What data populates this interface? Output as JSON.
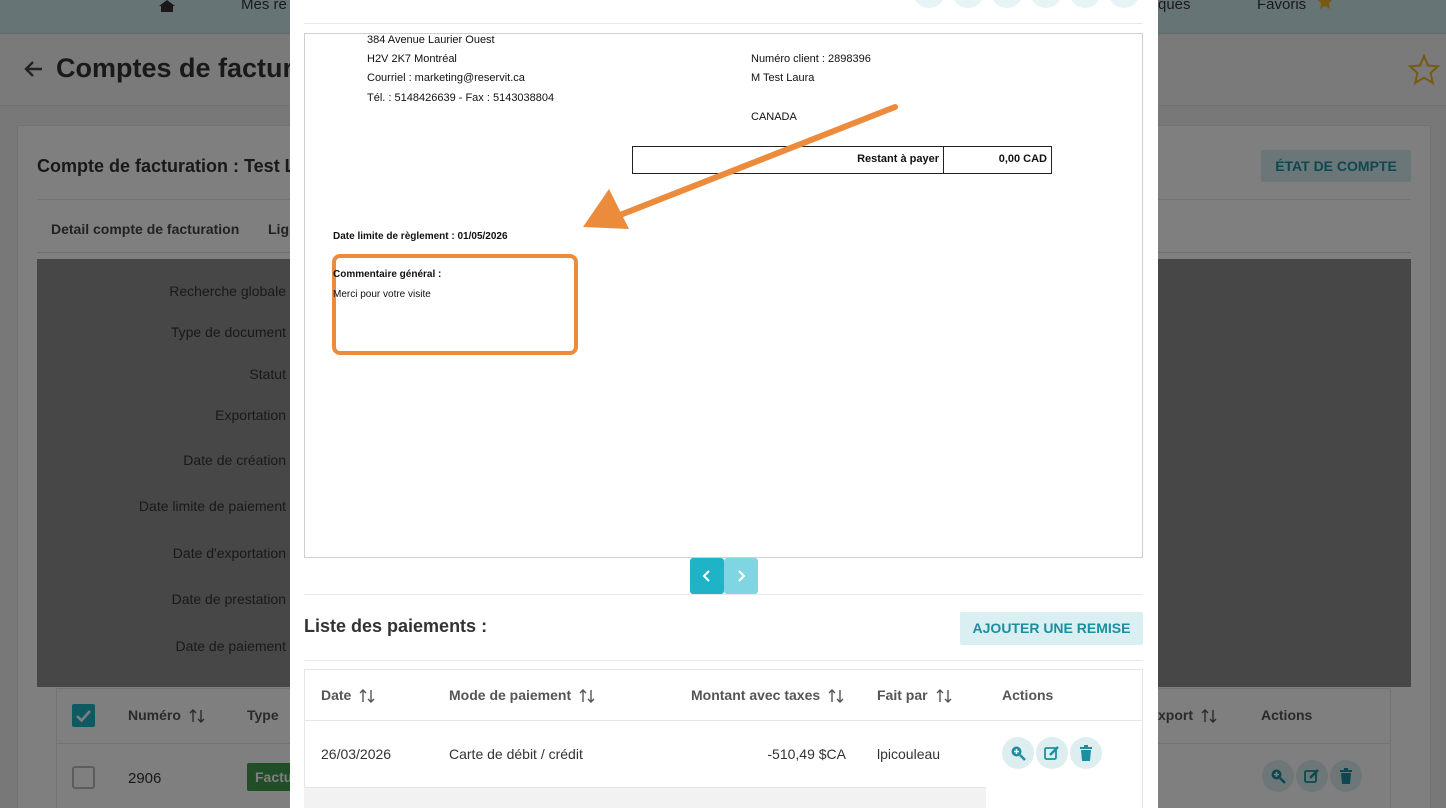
{
  "topnav": {
    "partial_left": "Mes re",
    "partial_right": "ques",
    "favoris": "Favoris"
  },
  "header": {
    "title": "Comptes de factura"
  },
  "account": {
    "title": "Compte de facturation : Test La",
    "etat_button": "ÉTAT DE COMPTE"
  },
  "tabs": [
    "Detail compte de facturation",
    "Lig"
  ],
  "filters": [
    "Recherche globale",
    "Type de document",
    "Statut",
    "Exportation",
    "Date de création",
    "Date limite de paiement",
    "Date d'exportation",
    "Date de prestation",
    "Date de paiement"
  ],
  "bg_table": {
    "headers": {
      "numero": "Numéro",
      "type": "Type",
      "export": "xport",
      "actions": "Actions"
    },
    "row": {
      "numero": "2906",
      "type": "Factu"
    }
  },
  "invoice": {
    "sender_lines": [
      "384 Avenue Laurier Ouest",
      "H2V 2K7 Montréal",
      "Courriel : marketing@reservit.ca",
      "Tél. : 5148426639 - Fax : 5143038804"
    ],
    "client_lines": [
      "Numéro client : 2898396",
      "M Test Laura",
      "CANADA"
    ],
    "restant_label": "Restant à payer",
    "restant_value": "0,00 CAD",
    "date_limite": "Date limite de règlement : 01/05/2026",
    "commentaire_label": "Commentaire général :",
    "commentaire_value": "Merci pour votre visite"
  },
  "payments": {
    "title": "Liste des paiements :",
    "add_button": "AJOUTER UNE REMISE",
    "headers": {
      "date": "Date",
      "mode": "Mode de paiement",
      "montant": "Montant avec taxes",
      "fait_par": "Fait par",
      "actions": "Actions"
    },
    "rows": [
      {
        "date": "26/03/2026",
        "mode": "Carte de débit / crédit",
        "montant": "-510,49 $CA",
        "fait_par": "lpicouleau"
      }
    ]
  },
  "colors": {
    "accent": "#1eb3c7",
    "highlight": "#ec8b3c",
    "badge_green": "#3f9c4f"
  }
}
